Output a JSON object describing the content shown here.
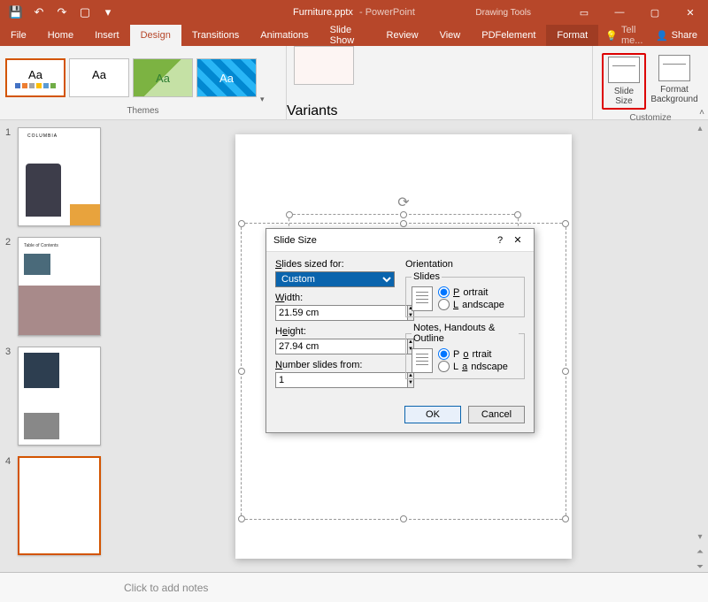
{
  "titlebar": {
    "filename": "Furniture.pptx",
    "appname": "- PowerPoint",
    "context_tools": "Drawing Tools"
  },
  "tabs": {
    "file": "File",
    "home": "Home",
    "insert": "Insert",
    "design": "Design",
    "transitions": "Transitions",
    "animations": "Animations",
    "slideshow": "Slide Show",
    "review": "Review",
    "view": "View",
    "pdfelement": "PDFelement",
    "format": "Format",
    "tellme": "Tell me...",
    "share": "Share"
  },
  "ribbon": {
    "themes_label": "Themes",
    "variants_label": "Variants",
    "customize_label": "Customize",
    "theme_aa": "Aa",
    "slide_size": "Slide Size",
    "format_bg": "Format Background"
  },
  "thumbnails": {
    "n1": "1",
    "n2": "2",
    "n3": "3",
    "n4": "4",
    "s1_title": "COLUMBIA",
    "s2_toc": "Table of Contents"
  },
  "notes_placeholder": "Click to add notes",
  "dialog": {
    "title": "Slide Size",
    "sized_for_label": "Slides sized for:",
    "sized_for_value": "Custom",
    "width_label": "Width:",
    "width_value": "21.59 cm",
    "height_label": "Height:",
    "height_value": "27.94 cm",
    "number_from_label": "Number slides from:",
    "number_from_value": "1",
    "orientation_label": "Orientation",
    "slides_legend": "Slides",
    "notes_legend": "Notes, Handouts & Outline",
    "portrait": "Portrait",
    "landscape": "Landscape",
    "ok": "OK",
    "cancel": "Cancel",
    "help": "?",
    "close": "✕"
  }
}
